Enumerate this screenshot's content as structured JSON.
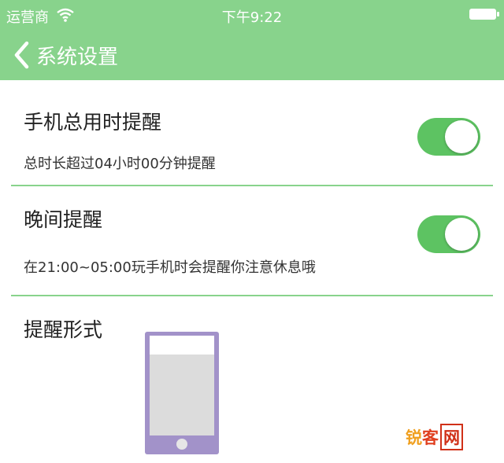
{
  "status_bar": {
    "carrier": "运营商",
    "time": "下午9:22",
    "wifi_icon": "wifi-icon",
    "battery_icon": "battery-icon"
  },
  "nav": {
    "back_icon": "chevron-left-icon",
    "title": "系统设置"
  },
  "settings": [
    {
      "title": "手机总用时提醒",
      "subtitle": "总时长超过04小时00分钟提醒",
      "enabled": true
    },
    {
      "title": "晚间提醒",
      "subtitle": "在21:00~05:00玩手机时会提醒你注意休息哦",
      "enabled": true
    },
    {
      "title": "提醒形式"
    }
  ],
  "watermark": {
    "part1": "锐",
    "part2": "客",
    "part3": "网"
  },
  "colors": {
    "header": "#88d38c",
    "toggle_on": "#5dc362",
    "divider": "#88d38c",
    "phone": "#a292c9"
  }
}
